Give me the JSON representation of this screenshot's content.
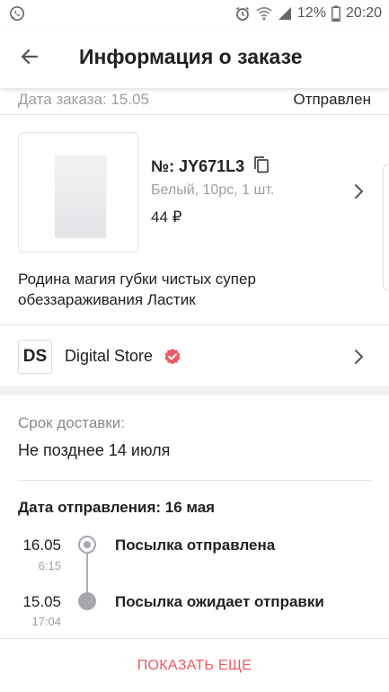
{
  "status_bar": {
    "battery_percent": "12%",
    "time": "20:20",
    "icons": [
      "whatsapp-icon",
      "alarm-icon",
      "wifi-icon",
      "signal-icon",
      "battery-icon"
    ]
  },
  "app_bar": {
    "title": "Информация о заказе",
    "back_icon": "arrow-left-icon"
  },
  "order": {
    "date_label": "Дата заказа: 15.05",
    "status": "Отправлен"
  },
  "product": {
    "order_number": "№: JY671L3",
    "variant": "Белый, 10pc, 1 шт.",
    "price": "44 ₽",
    "name": "Родина магия губки чистых супер обеззараживания Ластик",
    "copy_icon": "copy-icon",
    "chevron_icon": "chevron-right-icon"
  },
  "store": {
    "logo_text": "DS",
    "name": "Digital Store",
    "verified_icon": "verified-badge-icon",
    "badge_color": "#ef5a62"
  },
  "delivery": {
    "label": "Срок доставки:",
    "value": "Не позднее 14 июля"
  },
  "shipping": {
    "date_label": "Дата отправления: 16 мая",
    "events": [
      {
        "date": "16.05",
        "time": "6:15",
        "text": "Посылка отправлена"
      },
      {
        "date": "15.05",
        "time": "17:04",
        "text": "Посылка ожидает отправки"
      }
    ]
  },
  "actions": {
    "show_more": "ПОКАЗАТЬ ЕЩЕ",
    "accent_color": "#ef5a62"
  }
}
